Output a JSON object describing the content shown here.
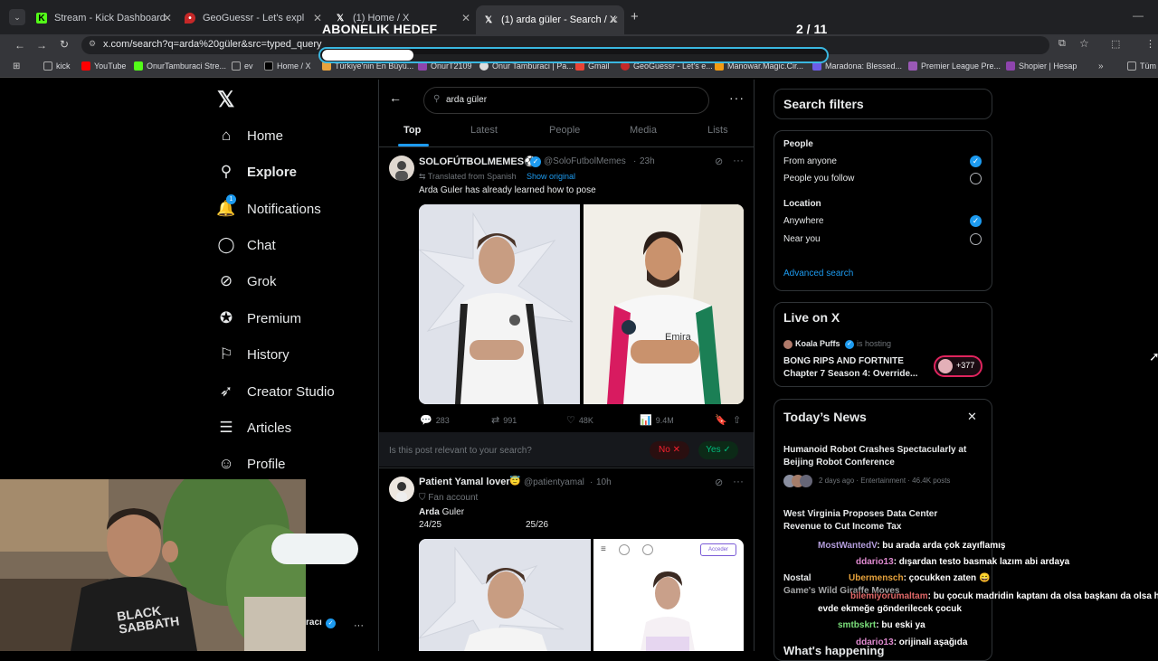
{
  "browser": {
    "tabs": [
      {
        "title": "Stream - Kick Dashboard",
        "active": false
      },
      {
        "title": "GeoGuessr - Let's explore the w",
        "active": false
      },
      {
        "title": "(1) Home / X",
        "active": false
      },
      {
        "title": "(1) arda güler - Search / X",
        "active": true
      }
    ],
    "url": "x.com/search?q=arda%20güler&src=typed_query",
    "bookmarks": [
      "kick",
      "YouTube",
      "OnurTamburaci Stre...",
      "ev",
      "Home / X",
      "Türkiye'nin En Büyü...",
      "OnurT2109",
      "Onur Tamburaci | Pa...",
      "Gmail",
      "GeoGuessr - Let's e...",
      "Manowar.Magic.Cir...",
      "Maradona: Blessed...",
      "Premier League Pre...",
      "Shopier | Hesap",
      "Tüm"
    ]
  },
  "overlay": {
    "title": "ABONELIK HEDEF",
    "count": "2 / 11",
    "progress": 0.18
  },
  "nav": {
    "items": [
      {
        "label": "Home",
        "icon": "home-icon"
      },
      {
        "label": "Explore",
        "icon": "search-icon"
      },
      {
        "label": "Notifications",
        "icon": "bell-icon"
      },
      {
        "label": "Chat",
        "icon": "chat-icon"
      },
      {
        "label": "Grok",
        "icon": "grok-icon"
      },
      {
        "label": "Premium",
        "icon": "premium-icon"
      },
      {
        "label": "History",
        "icon": "bookmark-icon"
      },
      {
        "label": "Creator Studio",
        "icon": "rocket-icon"
      },
      {
        "label": "Articles",
        "icon": "articles-icon"
      },
      {
        "label": "Profile",
        "icon": "person-icon"
      }
    ],
    "notif_badge": "1",
    "account_name_partial": "racı"
  },
  "search": {
    "query": "arda güler",
    "tabs": [
      "Top",
      "Latest",
      "People",
      "Media",
      "Lists"
    ]
  },
  "post1": {
    "name": "SOLOFÚTBOLMEMES⚽",
    "handle": "@SoloFutbolMemes",
    "time": "23h",
    "translated": "Translated from Spanish",
    "show_original": "Show original",
    "text": "Arda Guler has already learned how to pose",
    "replies": "283",
    "reposts": "991",
    "likes": "48K",
    "views": "9.4M"
  },
  "relevance": {
    "question": "Is this post relevant to your search?",
    "no": "No",
    "yes": "Yes"
  },
  "post2": {
    "name": "Patient Yamal lover",
    "handle": "@patientyamal",
    "time": "10h",
    "badge": "Fan account",
    "text_bold": "Arda",
    "text_rest": " Guler",
    "left_label": "24/25",
    "right_label": "25/26",
    "acceder": "Acceder"
  },
  "filters": {
    "title": "Search filters",
    "people_heading": "People",
    "people_options": [
      {
        "label": "From anyone",
        "checked": true
      },
      {
        "label": "People you follow",
        "checked": false
      }
    ],
    "location_heading": "Location",
    "location_options": [
      {
        "label": "Anywhere",
        "checked": true
      },
      {
        "label": "Near you",
        "checked": false
      }
    ],
    "advanced": "Advanced search"
  },
  "live": {
    "title": "Live on X",
    "host": "Koala Puffs",
    "hosting": "is hosting",
    "stream_title_1": "BONG RIPS AND FORTNITE",
    "stream_title_2": "Chapter 7 Season 4: Override...",
    "listeners": "+377"
  },
  "news": {
    "title": "Today’s News",
    "items": [
      {
        "headline_1": "Humanoid Robot Crashes Spectacularly at",
        "headline_2": "Beijing Robot Conference",
        "meta": "2 days ago · Entertainment · 46.4K posts"
      },
      {
        "headline_1": "West Virginia Proposes Data Center",
        "headline_2": "Revenue to Cut Income Tax"
      },
      {
        "headline_1": "Nostal",
        "headline_2": "Game's Wild Giraffe Moves"
      }
    ],
    "whats_happening": "What's happening"
  },
  "chat": [
    {
      "user": "MostWantedV",
      "user_color": "#b39ddb",
      "msg": ": bu arada arda çok zayıflamış"
    },
    {
      "user": "ddario13",
      "user_color": "#e08ad0",
      "msg": ": dışardan testo basmak lazım abi ardaya"
    },
    {
      "user": "Ubermensch",
      "user_color": "#e6a23c",
      "msg": ": çocukken zaten 😄"
    },
    {
      "user": "bilemiyorumaltam",
      "user_color": "#e06767",
      "msg": ": bu çocuk madridin kaptanı da olsa başkanı da olsa her daim"
    },
    {
      "user": "",
      "user_color": "#fff",
      "msg": "evde ekmeğe gönderilecek çocuk"
    },
    {
      "user": "smtbskrt",
      "user_color": "#7be07b",
      "msg": ": bu eski ya"
    },
    {
      "user": "ddario13",
      "user_color": "#e08ad0",
      "msg": ": orijinali aşağıda"
    }
  ],
  "webcam": {
    "shirt_text_1": "BLACK",
    "shirt_text_2": "SABBATH"
  }
}
